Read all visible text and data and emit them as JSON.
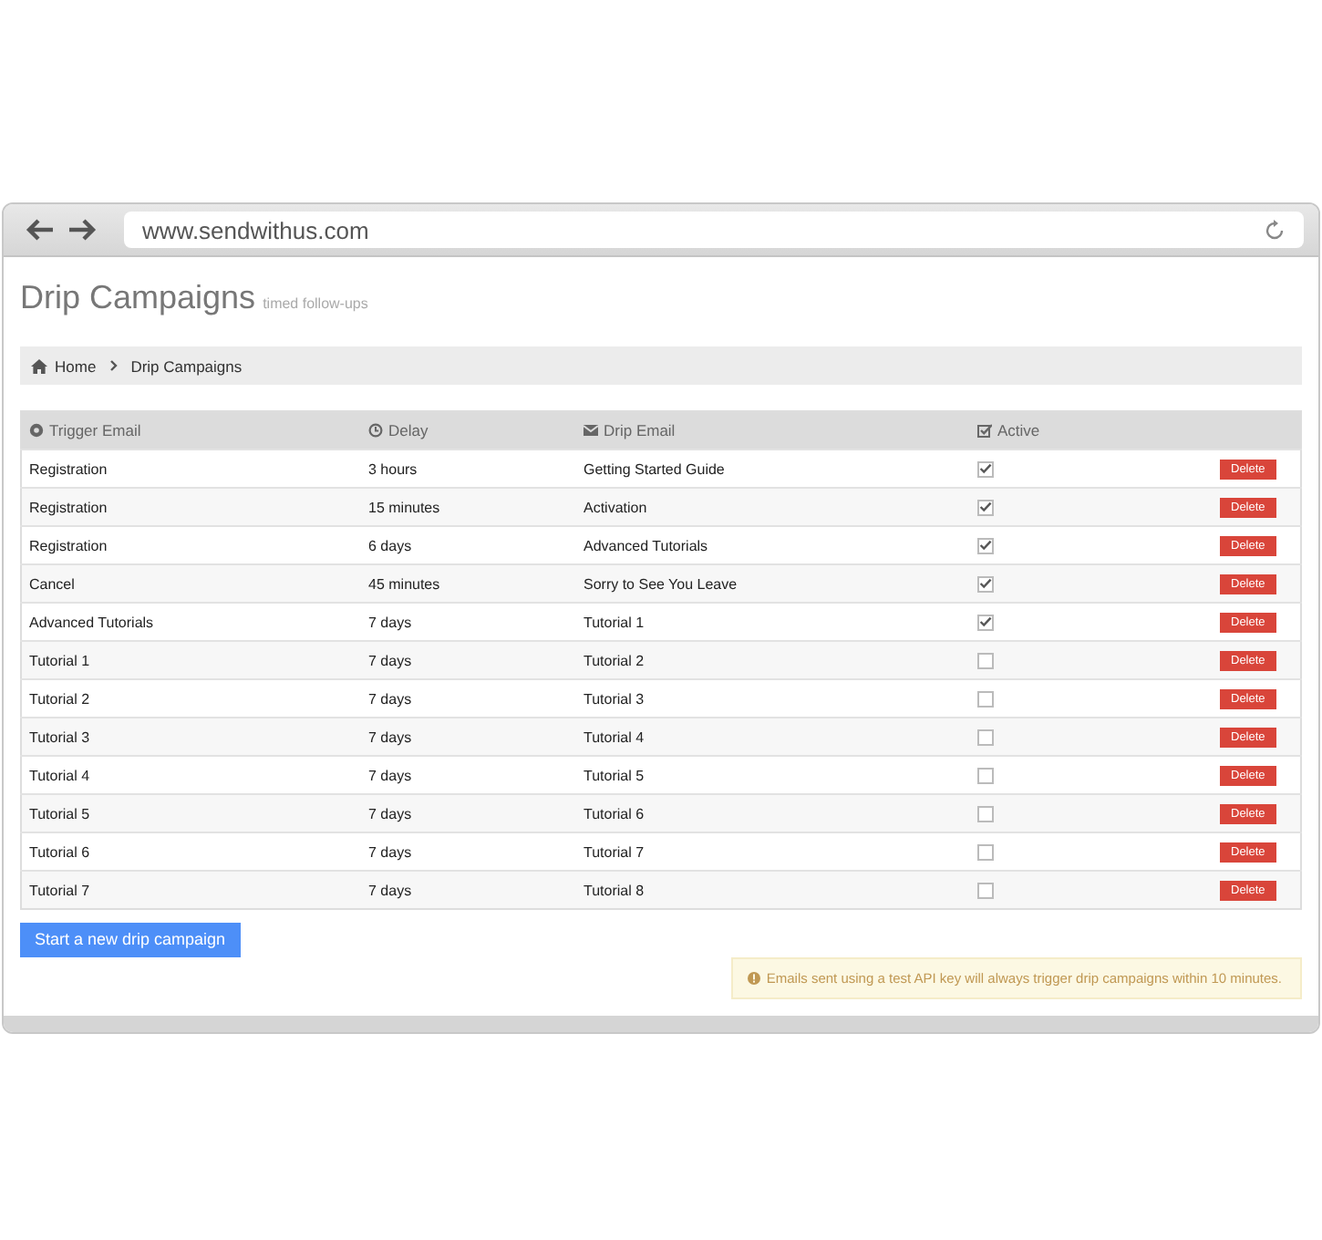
{
  "browser": {
    "url": "www.sendwithus.com"
  },
  "page": {
    "title": "Drip Campaigns",
    "subtitle": "timed follow-ups"
  },
  "breadcrumb": [
    "Home",
    "Drip Campaigns"
  ],
  "table": {
    "columns": [
      "Trigger Email",
      "Delay",
      "Drip Email",
      "Active"
    ],
    "rows": [
      {
        "trigger": "Registration",
        "delay": "3 hours",
        "drip": "Getting Started Guide",
        "active": true,
        "action": "Delete"
      },
      {
        "trigger": "Registration",
        "delay": "15 minutes",
        "drip": "Activation",
        "active": true,
        "action": "Delete"
      },
      {
        "trigger": "Registration",
        "delay": "6 days",
        "drip": "Advanced Tutorials",
        "active": true,
        "action": "Delete"
      },
      {
        "trigger": "Cancel",
        "delay": "45 minutes",
        "drip": "Sorry to See You Leave",
        "active": true,
        "action": "Delete"
      },
      {
        "trigger": "Advanced Tutorials",
        "delay": "7 days",
        "drip": "Tutorial 1",
        "active": true,
        "action": "Delete"
      },
      {
        "trigger": "Tutorial 1",
        "delay": "7 days",
        "drip": "Tutorial 2",
        "active": false,
        "action": "Delete"
      },
      {
        "trigger": "Tutorial 2",
        "delay": "7 days",
        "drip": "Tutorial 3",
        "active": false,
        "action": "Delete"
      },
      {
        "trigger": "Tutorial 3",
        "delay": "7 days",
        "drip": "Tutorial 4",
        "active": false,
        "action": "Delete"
      },
      {
        "trigger": "Tutorial 4",
        "delay": "7 days",
        "drip": "Tutorial 5",
        "active": false,
        "action": "Delete"
      },
      {
        "trigger": "Tutorial 5",
        "delay": "7 days",
        "drip": "Tutorial 6",
        "active": false,
        "action": "Delete"
      },
      {
        "trigger": "Tutorial 6",
        "delay": "7 days",
        "drip": "Tutorial 7",
        "active": false,
        "action": "Delete"
      },
      {
        "trigger": "Tutorial 7",
        "delay": "7 days",
        "drip": "Tutorial 8",
        "active": false,
        "action": "Delete"
      }
    ]
  },
  "new_button": "Start a new drip campaign",
  "notice": "Emails sent using a test API key will always trigger drip campaigns within 10 minutes."
}
